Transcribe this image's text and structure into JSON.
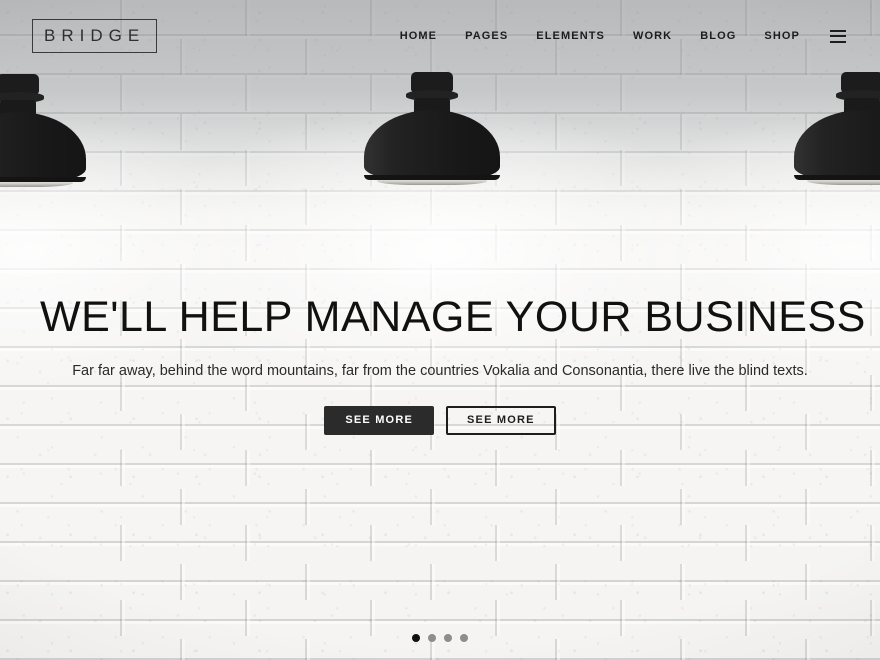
{
  "header": {
    "logo": {
      "text": "BRIDGE",
      "name": "bridge-logo"
    },
    "nav": [
      {
        "label": "HOME"
      },
      {
        "label": "PAGES"
      },
      {
        "label": "ELEMENTS"
      },
      {
        "label": "WORK"
      },
      {
        "label": "BLOG"
      },
      {
        "label": "SHOP"
      }
    ],
    "menu_icon": "hamburger-menu-icon"
  },
  "hero": {
    "title": "WE'LL HELP MANAGE YOUR BUSINESS",
    "subtitle": "Far far away, behind the word mountains, far from the countries Vokalia and Consonantia, there live the blind texts.",
    "primary_button": "SEE MORE",
    "secondary_button": "SEE MORE"
  },
  "slider": {
    "dots": [
      {
        "active": true
      },
      {
        "active": false
      },
      {
        "active": false
      },
      {
        "active": false
      }
    ],
    "active_index": 1,
    "total_slides": 4
  },
  "background": {
    "scene": "white-painted-brick-wall-with-black-industrial-pendant-lamps",
    "lamp_count": 3
  },
  "colors": {
    "text_dark": "#1d1d1d",
    "button_solid_bg": "#2b2b2b",
    "button_solid_text": "#ffffff",
    "logo_border": "#3a3a3a",
    "dot_active": "#111111",
    "dot_inactive": "#8d8d8d",
    "lamp_black": "#1b1b1b",
    "wall_white": "#f4f3f1"
  }
}
